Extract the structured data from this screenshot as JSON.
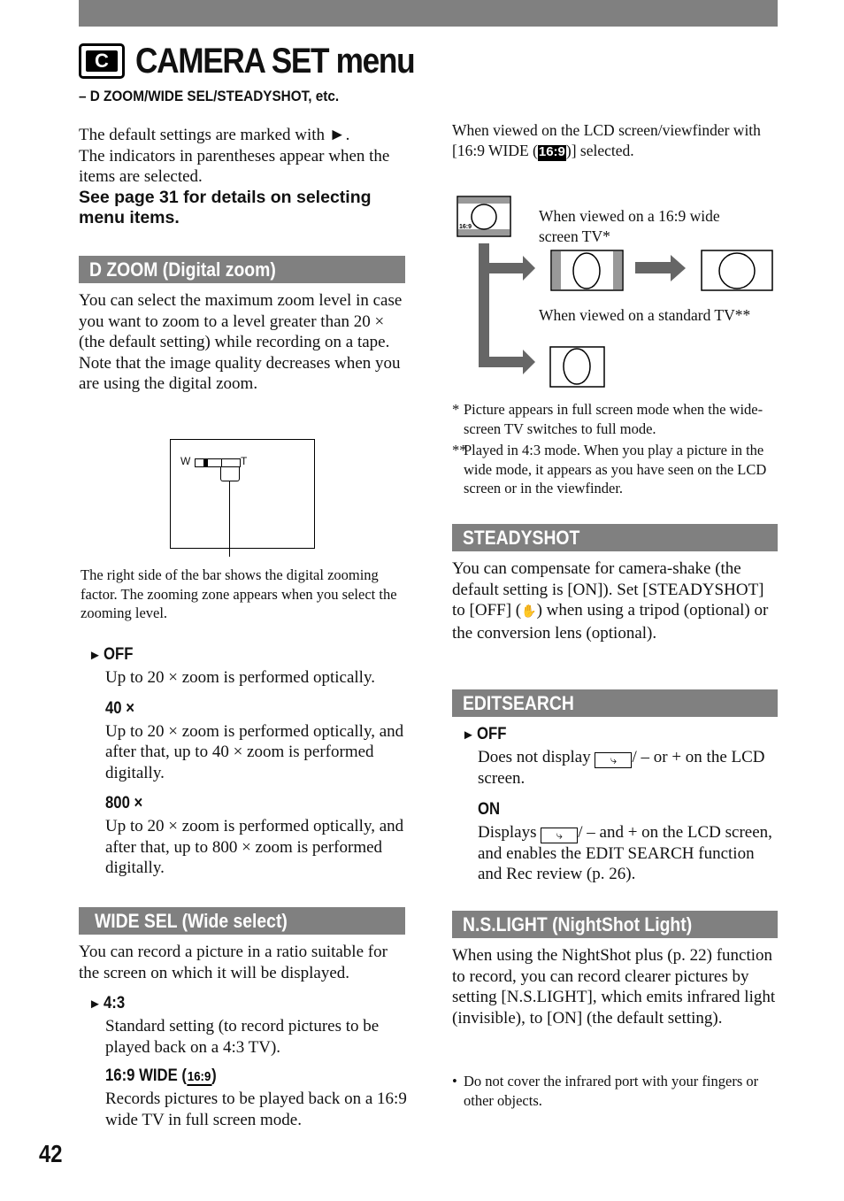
{
  "page": {
    "title": "CAMERA SET menu",
    "subtitle": "– D ZOOM/WIDE SEL/STEADYSHOT, etc.",
    "page_number": "42",
    "icon": "camera-set-icon",
    "icon_letter": "C"
  },
  "intro": {
    "line1": "The default settings are marked with ►.",
    "line2": "The indicators in parentheses appear when the items are selected.",
    "bold_note": "See page 31 for details on selecting menu items."
  },
  "dzoom": {
    "heading": "D ZOOM (Digital zoom)",
    "body": "You can select the maximum zoom level in case you want to zoom to a level greater than 20 × (the default setting) while recording on a tape. Note that the image quality decreases when you are using the digital zoom.",
    "diagram": {
      "w_label": "W",
      "t_label": "T"
    },
    "caption": "The right side of the bar shows the digital zooming factor. The zooming zone appears when you select the zooming level.",
    "options": [
      {
        "label": "OFF",
        "default": true,
        "desc": "Up to 20 × zoom is performed optically."
      },
      {
        "label": "40 ×",
        "default": false,
        "desc": "Up to 20 × zoom is performed optically, and after that, up to 40 × zoom is performed digitally."
      },
      {
        "label": "800 ×",
        "default": false,
        "desc": "Up to 20 × zoom is performed optically, and after that, up to 800 × zoom is performed digitally."
      }
    ]
  },
  "widesel": {
    "heading": "WIDE SEL (Wide select)",
    "body": "You can record a picture in a ratio suitable for the screen on which it will be displayed.",
    "options": [
      {
        "label": "4:3",
        "default": true,
        "desc": "Standard setting (to record pictures to be played back on a 4:3 TV)."
      },
      {
        "label": "16:9 WIDE (",
        "indicator": "16:9",
        "suffix": ")",
        "default": false,
        "desc": "Records pictures to be played back on a 16:9 wide TV in full screen mode."
      }
    ]
  },
  "right_intro": {
    "text_before": "When viewed on the LCD screen/viewfinder with [16:9 WIDE (",
    "indicator": "16:9",
    "text_after": ")] selected."
  },
  "tv_diagram": {
    "lcd_indicator": "16:9",
    "wide_label": "When viewed on a 16:9 wide screen TV*",
    "standard_label": "When viewed on a standard TV**"
  },
  "footnotes": [
    {
      "mark": "*",
      "text": "Picture appears in full screen mode when the wide-screen TV switches to full mode."
    },
    {
      "mark": "**",
      "text": "Played in 4:3 mode. When you play a picture in the wide mode, it appears as you have seen on the LCD screen or in the viewfinder."
    }
  ],
  "steadyshot": {
    "heading": "STEADYSHOT",
    "body_before": "You can compensate for camera-shake (the default setting is [ON]). Set [STEADYSHOT] to [OFF] (",
    "icon": "steadyshot-off-icon",
    "body_after": ") when using a tripod (optional) or the conversion lens (optional)."
  },
  "editsearch": {
    "heading": "EDITSEARCH",
    "options": [
      {
        "label": "OFF",
        "default": true,
        "desc_before": "Does not display ",
        "desc_after": "/ – or + on the LCD screen."
      },
      {
        "label": "ON",
        "default": false,
        "desc_before": "Displays ",
        "desc_after": "/ – and + on the LCD screen, and enables the EDIT SEARCH function and Rec review (p. 26)."
      }
    ]
  },
  "nslight": {
    "heading": "N.S.LIGHT (NightShot Light)",
    "body": "When using the NightShot plus (p. 22) function to record, you can record clearer pictures by setting [N.S.LIGHT], which emits infrared light (invisible), to [ON] (the default setting).",
    "bullet": "Do not cover the infrared port with your fingers or other objects."
  },
  "colors": {
    "bar": "#808080",
    "text": "#111111",
    "diagram_arrow": "#666666"
  }
}
